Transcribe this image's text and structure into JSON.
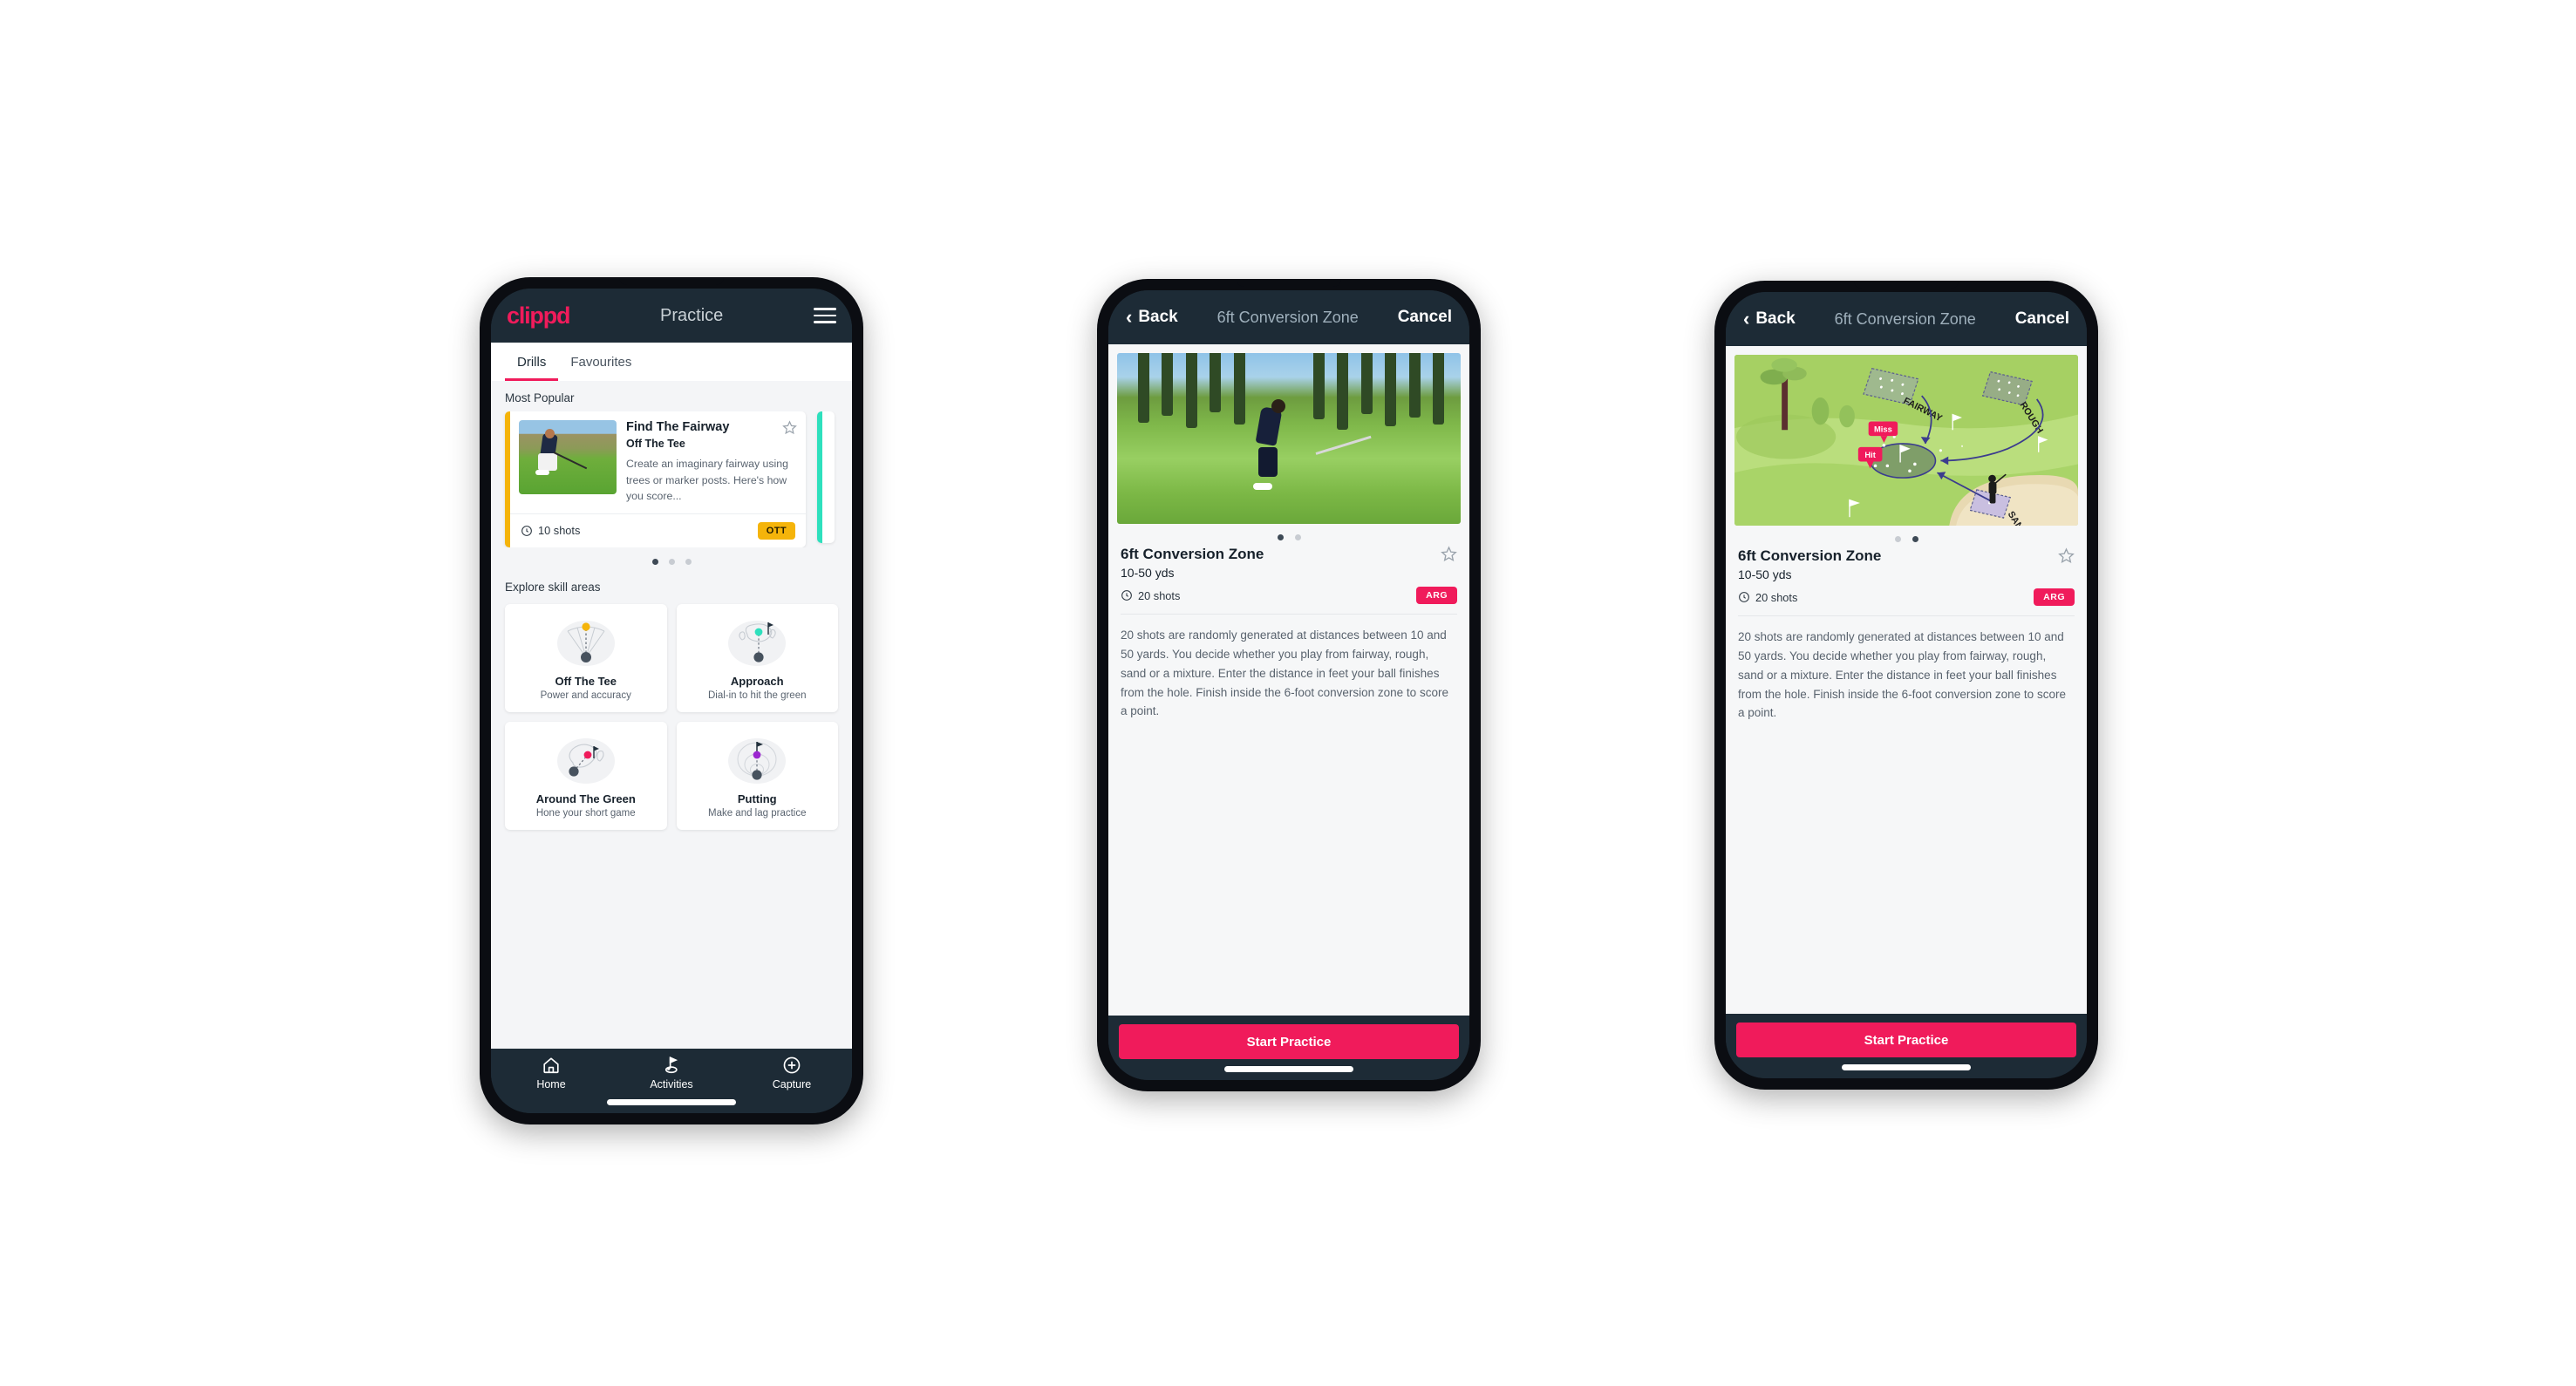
{
  "app": {
    "brand": "clippd",
    "accent": "#f01b5b",
    "dark": "#1d2b36",
    "amber": "#f5b40a",
    "teal": "#2ee0bd"
  },
  "phone1": {
    "header": {
      "logo": "clippd",
      "title": "Practice",
      "menu_icon": "hamburger-icon"
    },
    "tabs": [
      {
        "label": "Drills",
        "active": true
      },
      {
        "label": "Favourites",
        "active": false
      }
    ],
    "most_popular_label": "Most Popular",
    "popular_card": {
      "title": "Find The Fairway",
      "subtitle": "Off The Tee",
      "description": "Create an imaginary fairway using trees or marker posts. Here's how you score...",
      "shots": "10 shots",
      "badge": "OTT",
      "badge_color": "#f5b40a",
      "accent_bar": "#f5b40a",
      "favourite_icon": "star-outline-icon"
    },
    "carousel_dots": {
      "count": 3,
      "active_index": 0
    },
    "explore_label": "Explore skill areas",
    "skills": [
      {
        "name": "Off The Tee",
        "desc": "Power and accuracy",
        "icon": "tee-fan-icon",
        "dot_color": "#f5b40a"
      },
      {
        "name": "Approach",
        "desc": "Dial-in to hit the green",
        "icon": "approach-green-icon",
        "dot_color": "#2ee0bd"
      },
      {
        "name": "Around The Green",
        "desc": "Hone your short game",
        "icon": "around-green-icon",
        "dot_color": "#f01b5b"
      },
      {
        "name": "Putting",
        "desc": "Make and lag practice",
        "icon": "putting-rings-icon",
        "dot_color": "#9c27d0"
      }
    ],
    "tabbar": [
      {
        "label": "Home",
        "icon": "home-icon",
        "active": false
      },
      {
        "label": "Activities",
        "icon": "golf-flag-icon",
        "active": true
      },
      {
        "label": "Capture",
        "icon": "plus-circle-icon",
        "active": false
      }
    ]
  },
  "phone2": {
    "nav": {
      "back": "Back",
      "title": "6ft Conversion Zone",
      "cancel": "Cancel",
      "back_icon": "chevron-left-icon"
    },
    "hero_kind": "photo",
    "dots": {
      "count": 2,
      "active_index": 0
    },
    "title": "6ft Conversion Zone",
    "yards": "10-50 yds",
    "shots": "20 shots",
    "badge": "ARG",
    "badge_color": "#f01b5b",
    "favourite_icon": "star-outline-icon",
    "description": "20 shots are randomly generated at distances between 10 and 50 yards. You decide whether you play from fairway, rough, sand or a mixture. Enter the distance in feet your ball finishes from the hole. Finish inside the 6-foot conversion zone to score a point.",
    "cta": "Start Practice"
  },
  "phone3": {
    "nav": {
      "back": "Back",
      "title": "6ft Conversion Zone",
      "cancel": "Cancel",
      "back_icon": "chevron-left-icon"
    },
    "hero_kind": "illustration",
    "illustration": {
      "labels": [
        "FAIRWAY",
        "ROUGH",
        "SAND"
      ],
      "markers": [
        {
          "text": "Miss",
          "color": "#f01b5b"
        },
        {
          "text": "Hit",
          "color": "#f01b5b"
        }
      ]
    },
    "dots": {
      "count": 2,
      "active_index": 1
    },
    "title": "6ft Conversion Zone",
    "yards": "10-50 yds",
    "shots": "20 shots",
    "badge": "ARG",
    "badge_color": "#f01b5b",
    "favourite_icon": "star-outline-icon",
    "description": "20 shots are randomly generated at distances between 10 and 50 yards. You decide whether you play from fairway, rough, sand or a mixture. Enter the distance in feet your ball finishes from the hole. Finish inside the 6-foot conversion zone to score a point.",
    "cta": "Start Practice"
  }
}
